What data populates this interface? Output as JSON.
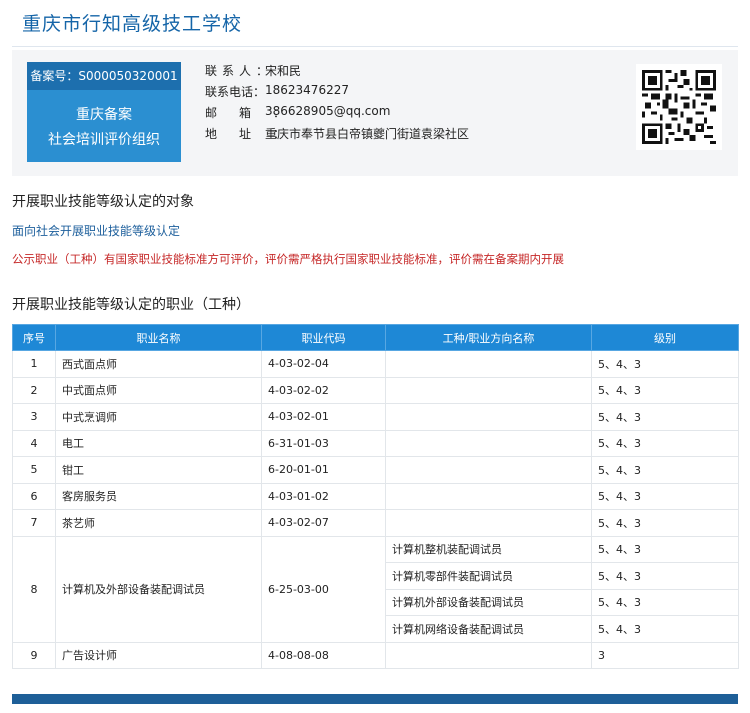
{
  "school_name": "重庆市行知高级技工学校",
  "org_card": {
    "record_no": "备案号：S000050320001",
    "badge_line1": "重庆备案",
    "badge_line2": "社会培训评价组织",
    "contacts": [
      {
        "label": "联系人：",
        "value": "宋和民"
      },
      {
        "label": "联系电话：",
        "value": "18623476227"
      },
      {
        "label": "邮箱：",
        "value": "386628905@qq.com"
      },
      {
        "label": "地址：",
        "value": "重庆市奉节县白帝镇夔门街道袁梁社区"
      }
    ]
  },
  "section_target": {
    "title": "开展职业技能等级认定的对象",
    "text": "面向社会开展职业技能等级认定",
    "notice": "公示职业（工种）有国家职业技能标准方可评价，评价需严格执行国家职业技能标准，评价需在备案期内开展"
  },
  "section_jobs": {
    "title": "开展职业技能等级认定的职业（工种）",
    "headers": [
      "序号",
      "职业名称",
      "职业代码",
      "工种/职业方向名称",
      "级别"
    ],
    "rows": [
      {
        "no": "1",
        "name": "西式面点师",
        "code": "4-03-02-04",
        "directions": [
          {
            "dir": "",
            "level": "5、4、3"
          }
        ]
      },
      {
        "no": "2",
        "name": "中式面点师",
        "code": "4-03-02-02",
        "directions": [
          {
            "dir": "",
            "level": "5、4、3"
          }
        ]
      },
      {
        "no": "3",
        "name": "中式烹调师",
        "code": "4-03-02-01",
        "directions": [
          {
            "dir": "",
            "level": "5、4、3"
          }
        ]
      },
      {
        "no": "4",
        "name": "电工",
        "code": "6-31-01-03",
        "directions": [
          {
            "dir": "",
            "level": "5、4、3"
          }
        ]
      },
      {
        "no": "5",
        "name": "钳工",
        "code": "6-20-01-01",
        "directions": [
          {
            "dir": "",
            "level": "5、4、3"
          }
        ]
      },
      {
        "no": "6",
        "name": "客房服务员",
        "code": "4-03-01-02",
        "directions": [
          {
            "dir": "",
            "level": "5、4、3"
          }
        ]
      },
      {
        "no": "7",
        "name": "茶艺师",
        "code": "4-03-02-07",
        "directions": [
          {
            "dir": "",
            "level": "5、4、3"
          }
        ]
      },
      {
        "no": "8",
        "name": "计算机及外部设备装配调试员",
        "code": "6-25-03-00",
        "directions": [
          {
            "dir": "计算机整机装配调试员",
            "level": "5、4、3"
          },
          {
            "dir": "计算机零部件装配调试员",
            "level": "5、4、3"
          },
          {
            "dir": "计算机外部设备装配调试员",
            "level": "5、4、3"
          },
          {
            "dir": "计算机网络设备装配调试员",
            "level": "5、4、3"
          }
        ]
      },
      {
        "no": "9",
        "name": "广告设计师",
        "code": "4-08-08-08",
        "directions": [
          {
            "dir": "",
            "level": "3"
          }
        ]
      }
    ]
  },
  "colors": {
    "title_blue": "#1565a8",
    "header_blue": "#1e88d6",
    "badge_blue": "#2b8fd1",
    "notice_red": "#c62828",
    "footer_bar": "#1e5f98"
  },
  "icons": {
    "qr": "qr-code"
  }
}
